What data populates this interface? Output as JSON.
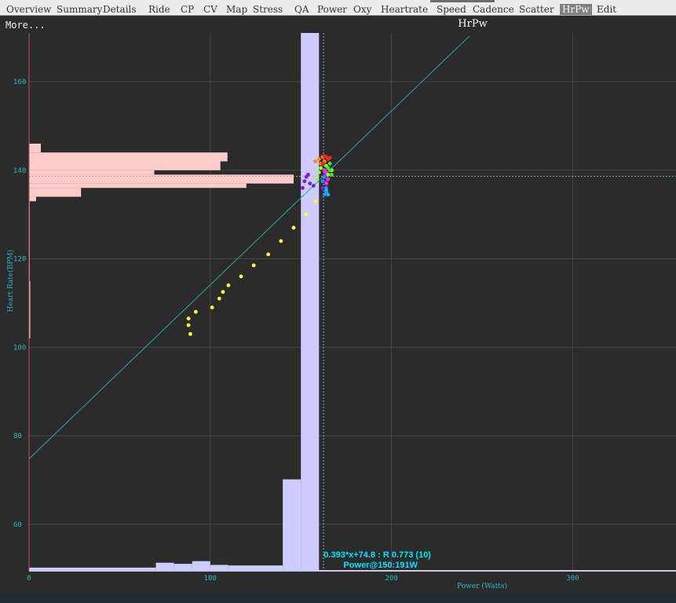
{
  "tabs": [
    {
      "label": "Overview"
    },
    {
      "label": "Summary"
    },
    {
      "label": "Details"
    },
    {
      "label": "Ride"
    },
    {
      "label": "CP"
    },
    {
      "label": "CV"
    },
    {
      "label": "Map"
    },
    {
      "label": "Stress"
    },
    {
      "label": "QA"
    },
    {
      "label": "Power"
    },
    {
      "label": "Oxy"
    },
    {
      "label": "Heartrate"
    },
    {
      "label": "Speed"
    },
    {
      "label": "Cadence"
    },
    {
      "label": "Scatter"
    },
    {
      "label": "HrPw",
      "active": true
    },
    {
      "label": "Edit"
    }
  ],
  "more_label": "More...",
  "colors": {
    "background": "#2b2b2b",
    "power_hist": "#ccccff",
    "hr_hist": "#ffcccc",
    "regression": "#2aa3a8",
    "axis_text": "#27b5c4",
    "annotation": "#00e5ff",
    "left_axis": "#b05a5a"
  },
  "chart_data": {
    "type": "scatter",
    "title": "HrPw",
    "xlabel": "Power (Watts)",
    "ylabel": "Heart Rate(BPM)",
    "xlim": [
      0,
      357
    ],
    "ylim": [
      49.5,
      171
    ],
    "xticks": [
      0,
      100,
      200,
      300
    ],
    "yticks": [
      60,
      80,
      100,
      120,
      140,
      160
    ],
    "grid": true,
    "crosshair": {
      "x": 162.5,
      "y": 138.6
    },
    "regression": {
      "slope": 0.393,
      "intercept": 74.8,
      "label": "0.393*x+74.8 : R 0.773 (10)"
    },
    "annotation": "Power@150:191W",
    "power_histogram": {
      "bins": [
        {
          "x0": 0,
          "x1": 70,
          "value": 0.6
        },
        {
          "x0": 70,
          "x1": 80,
          "value": 1.5
        },
        {
          "x0": 80,
          "x1": 90,
          "value": 1.3
        },
        {
          "x0": 90,
          "x1": 100,
          "value": 1.8
        },
        {
          "x0": 100,
          "x1": 110,
          "value": 1.1
        },
        {
          "x0": 110,
          "x1": 140,
          "value": 1.0
        },
        {
          "x0": 140,
          "x1": 150,
          "value": 17.0
        },
        {
          "x0": 150,
          "x1": 160,
          "value": 100
        }
      ]
    },
    "hr_histogram": {
      "bins": [
        {
          "y0": 102,
          "y1": 115,
          "value": 0.5
        },
        {
          "y0": 115,
          "y1": 133,
          "value": 0.3
        },
        {
          "y0": 133,
          "y1": 134,
          "value": 3
        },
        {
          "y0": 134,
          "y1": 136,
          "value": 22
        },
        {
          "y0": 136,
          "y1": 137,
          "value": 92
        },
        {
          "y0": 137,
          "y1": 139,
          "value": 112
        },
        {
          "y0": 139,
          "y1": 140,
          "value": 53
        },
        {
          "y0": 140,
          "y1": 142,
          "value": 81
        },
        {
          "y0": 142,
          "y1": 144,
          "value": 84
        },
        {
          "y0": 144,
          "y1": 146,
          "value": 5
        }
      ]
    },
    "series": [
      {
        "color": "#ffff33",
        "points": [
          [
            89,
            103
          ],
          [
            88,
            105
          ],
          [
            88,
            106.5
          ],
          [
            92,
            108
          ],
          [
            101,
            109
          ],
          [
            105,
            111
          ],
          [
            107,
            112.5
          ],
          [
            110,
            114
          ],
          [
            117,
            116
          ],
          [
            124,
            118.5
          ],
          [
            132,
            121
          ],
          [
            139,
            124
          ],
          [
            146,
            127
          ],
          [
            153,
            130
          ],
          [
            158,
            133
          ]
        ]
      },
      {
        "color": "#7a1cf0",
        "points": [
          [
            151,
            136
          ],
          [
            152,
            137.5
          ],
          [
            153,
            138.5
          ],
          [
            154,
            139
          ],
          [
            155,
            137
          ],
          [
            157,
            136.5
          ],
          [
            162,
            136
          ],
          [
            164,
            137.5
          ],
          [
            163,
            139
          ]
        ]
      },
      {
        "color": "#2b8cff",
        "points": [
          [
            163,
            134.5
          ],
          [
            164,
            135
          ],
          [
            164,
            136
          ],
          [
            162,
            137.5
          ],
          [
            163,
            138.5
          ]
        ]
      },
      {
        "color": "#ff33cc",
        "points": [
          [
            164,
            137
          ],
          [
            165,
            138
          ],
          [
            164,
            139.5
          ],
          [
            163,
            140
          ]
        ]
      },
      {
        "color": "#99ff33",
        "points": [
          [
            159,
            138
          ],
          [
            160,
            139.5
          ],
          [
            161,
            140.5
          ],
          [
            165,
            139
          ],
          [
            167,
            140
          ],
          [
            164,
            141
          ]
        ]
      },
      {
        "color": "#33ee33",
        "points": [
          [
            166,
            140
          ],
          [
            167,
            139
          ],
          [
            165,
            140.5
          ],
          [
            166,
            141.5
          ]
        ]
      },
      {
        "color": "#ff8800",
        "points": [
          [
            158,
            142
          ],
          [
            160,
            142.5
          ],
          [
            162,
            143
          ],
          [
            163,
            142
          ],
          [
            161,
            141.5
          ]
        ]
      },
      {
        "color": "#ff2222",
        "points": [
          [
            164,
            143
          ],
          [
            165,
            142.5
          ],
          [
            163,
            143.2
          ],
          [
            166,
            142.8
          ],
          [
            162,
            141.5
          ]
        ]
      },
      {
        "color": "#00bbff",
        "points": [
          [
            165,
            134.5
          ],
          [
            164,
            135.5
          ]
        ]
      }
    ]
  }
}
